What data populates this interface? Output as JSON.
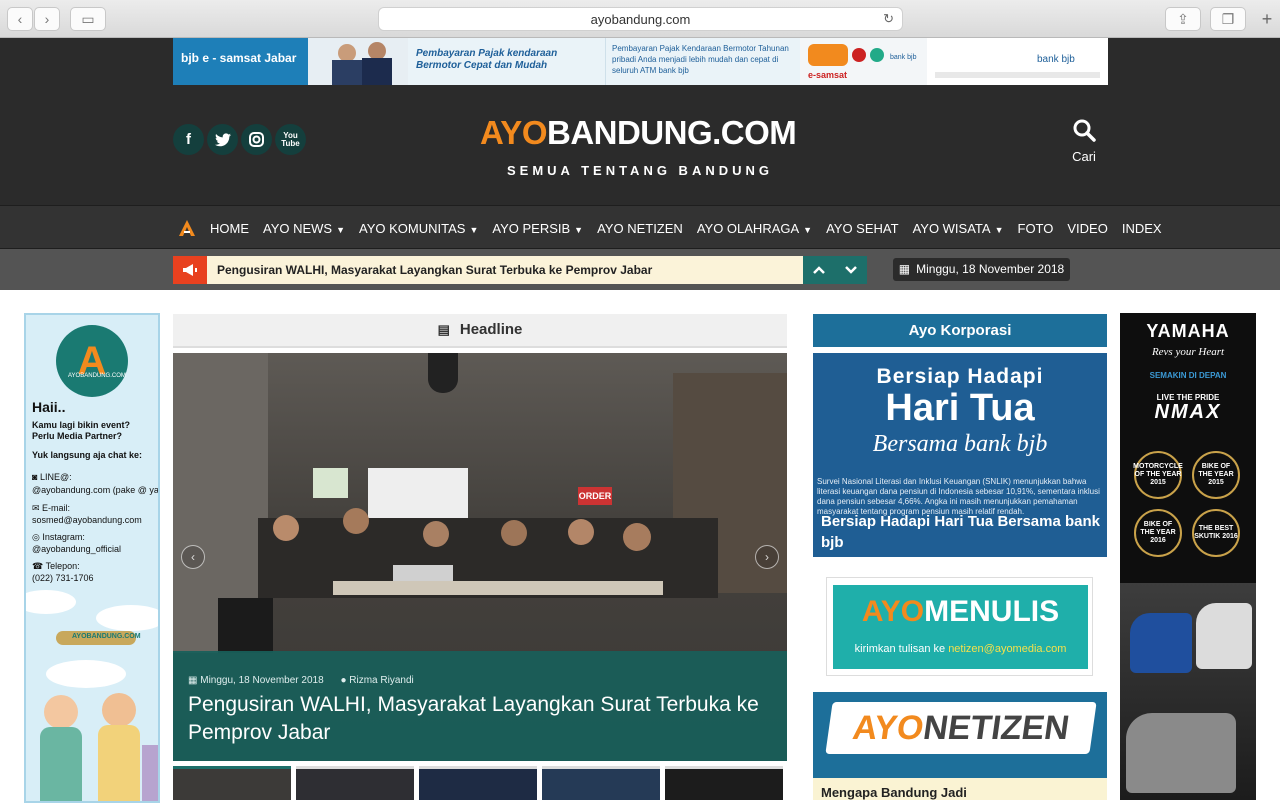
{
  "browser": {
    "url": "ayobandung.com"
  },
  "banner": {
    "seg1": "bjb  e - samsat Jabar",
    "seg2": "Pembayaran Pajak kendaraan Bermotor Cepat dan Mudah",
    "seg3": "Pembayaran Pajak Kendaraan Bermotor Tahunan pribadi Anda menjadi lebih mudah dan cepat di seluruh ATM bank bjb",
    "seg4": "e-samsat",
    "seg5": "bank bjb"
  },
  "header": {
    "logo_ayo": "AYO",
    "logo_rest": "BANDUNG.COM",
    "tagline": "SEMUA TENTANG BANDUNG",
    "search_label": "Cari"
  },
  "nav": {
    "items": [
      {
        "label": "HOME",
        "dropdown": false
      },
      {
        "label": "AYO NEWS",
        "dropdown": true
      },
      {
        "label": "AYO KOMUNITAS",
        "dropdown": true
      },
      {
        "label": "AYO PERSIB",
        "dropdown": true
      },
      {
        "label": "AYO NETIZEN",
        "dropdown": false
      },
      {
        "label": "AYO OLAHRAGA",
        "dropdown": true
      },
      {
        "label": "AYO SEHAT",
        "dropdown": false
      },
      {
        "label": "AYO WISATA",
        "dropdown": true
      },
      {
        "label": "FOTO",
        "dropdown": false
      },
      {
        "label": "VIDEO",
        "dropdown": false
      },
      {
        "label": "INDEX",
        "dropdown": false
      }
    ]
  },
  "ticker": {
    "text": "Pengusiran WALHI, Masyarakat Layangkan Surat Terbuka ke Pemprov Jabar",
    "date": "Minggu, 18 November 2018"
  },
  "left_ad": {
    "brand": "AYOBANDUNG.COM",
    "hi": "Haii..",
    "l1": "Kamu lagi bikin event?",
    "l2": "Perlu Media Partner?",
    "l3": "Yuk langsung aja chat ke:",
    "line_label": "LINE@:",
    "line_value": "@ayobandung.com (pake @ yaa)",
    "email_label": "E-mail:",
    "email_value": "sosmed@ayobandung.com",
    "ig_label": "Instagram:",
    "ig_value": "@ayobandung_official",
    "tel_label": "Telepon:",
    "tel_value": "(022) 731-1706",
    "plane_text": "AYOBANDUNG.COM"
  },
  "headline": {
    "section_title": "Headline",
    "date": "Minggu, 18 November 2018",
    "author": "Rizma Riyandi",
    "title": "Pengusiran WALHI, Masyarakat Layangkan Surat Terbuka ke Pemprov Jabar",
    "photo_sign": "ORDER"
  },
  "korporasi": {
    "title": "Ayo Korporasi",
    "h1": "Bersiap Hadapi",
    "h2": "Hari Tua",
    "h3": "Bersama bank bjb",
    "body": "Survei Nasional Literasi dan Inklusi Keuangan (SNLIK) menunjukkan bahwa literasi keuangan dana pensiun di Indonesia sebesar 10,91%, sementara inklusi dana pensiun sebesar 4,66%. Angka ini masih menunjukkan pemahaman masyarakat tentang program pensiun masih relatif rendah.",
    "caption": "Bersiap Hadapi Hari Tua Bersama bank bjb"
  },
  "menulis": {
    "ayo": "AYO",
    "word": "MENULIS",
    "sub": "kirimkan tulisan ke ",
    "email": "netizen@ayomedia.com"
  },
  "netizen": {
    "ayo": "AYO",
    "word": "NETIZEN",
    "sub": "Mengapa Bandung Jadi"
  },
  "right_ad": {
    "brand": "YAMAHA",
    "tag": "Revs your Heart",
    "semakin": "SEMAKIN DI DEPAN",
    "pride": "LIVE THE PRIDE",
    "model": "NMAX",
    "a1": "MOTORCYCLE OF THE YEAR 2015",
    "a2": "BIKE OF THE YEAR 2015",
    "a3": "BIKE OF THE YEAR 2016",
    "a4": "THE BEST SKUTIK 2016"
  },
  "colors": {
    "header_bg": "#2b2b2b",
    "accent_orange": "#f28a1e",
    "teal": "#1d6f6a",
    "blue": "#1d6f9a",
    "ticker_red": "#e8411f"
  }
}
